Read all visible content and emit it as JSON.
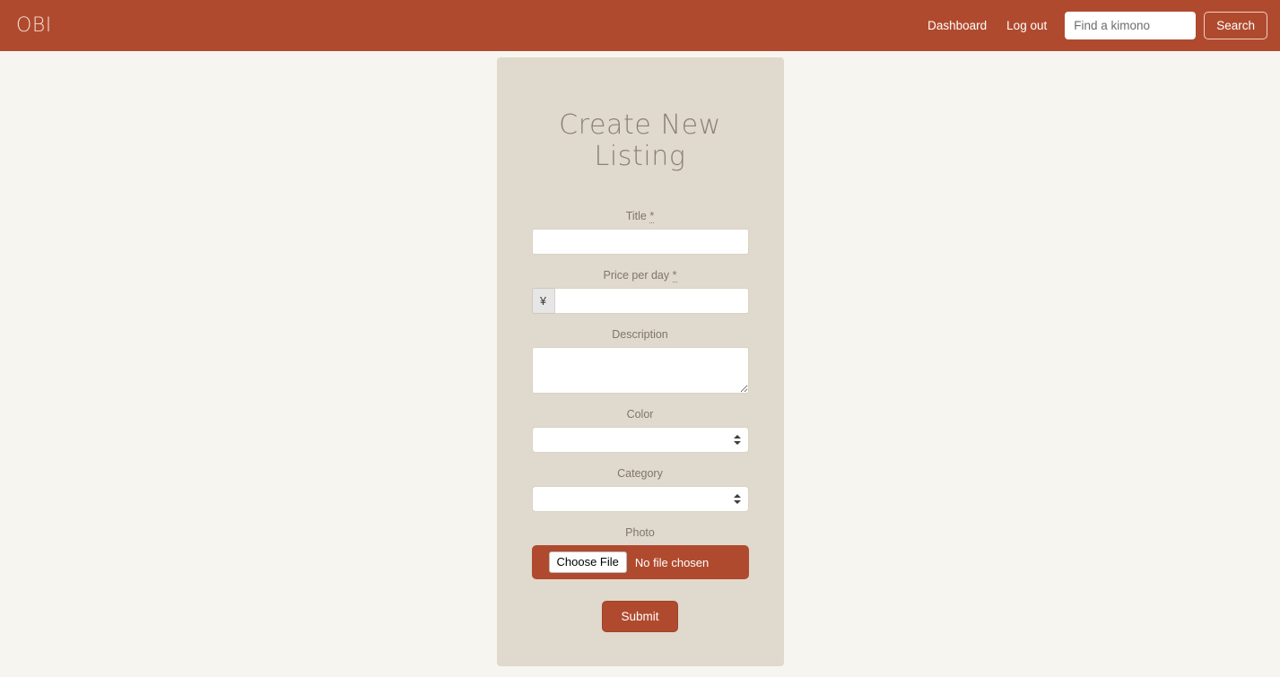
{
  "header": {
    "brand": "OBI",
    "nav_links": [
      {
        "label": "Dashboard"
      },
      {
        "label": "Log out"
      }
    ],
    "search": {
      "placeholder": "Find a kimono",
      "value": "",
      "button_label": "Search"
    },
    "background_color": "#b04a2e"
  },
  "form": {
    "title": "Create New Listing",
    "fields": {
      "title": {
        "label": "Title",
        "required_marker": "*",
        "value": ""
      },
      "price": {
        "label": "Price per day",
        "required_marker": "*",
        "currency_symbol": "¥",
        "value": ""
      },
      "description": {
        "label": "Description",
        "value": ""
      },
      "color": {
        "label": "Color",
        "selected": ""
      },
      "category": {
        "label": "Category",
        "selected": ""
      },
      "photo": {
        "label": "Photo",
        "choose_file_label": "Choose File",
        "file_status": "No file chosen"
      }
    },
    "submit_label": "Submit",
    "card_background": "#e0d9cd"
  },
  "page": {
    "background_color": "#f7f5f0"
  }
}
